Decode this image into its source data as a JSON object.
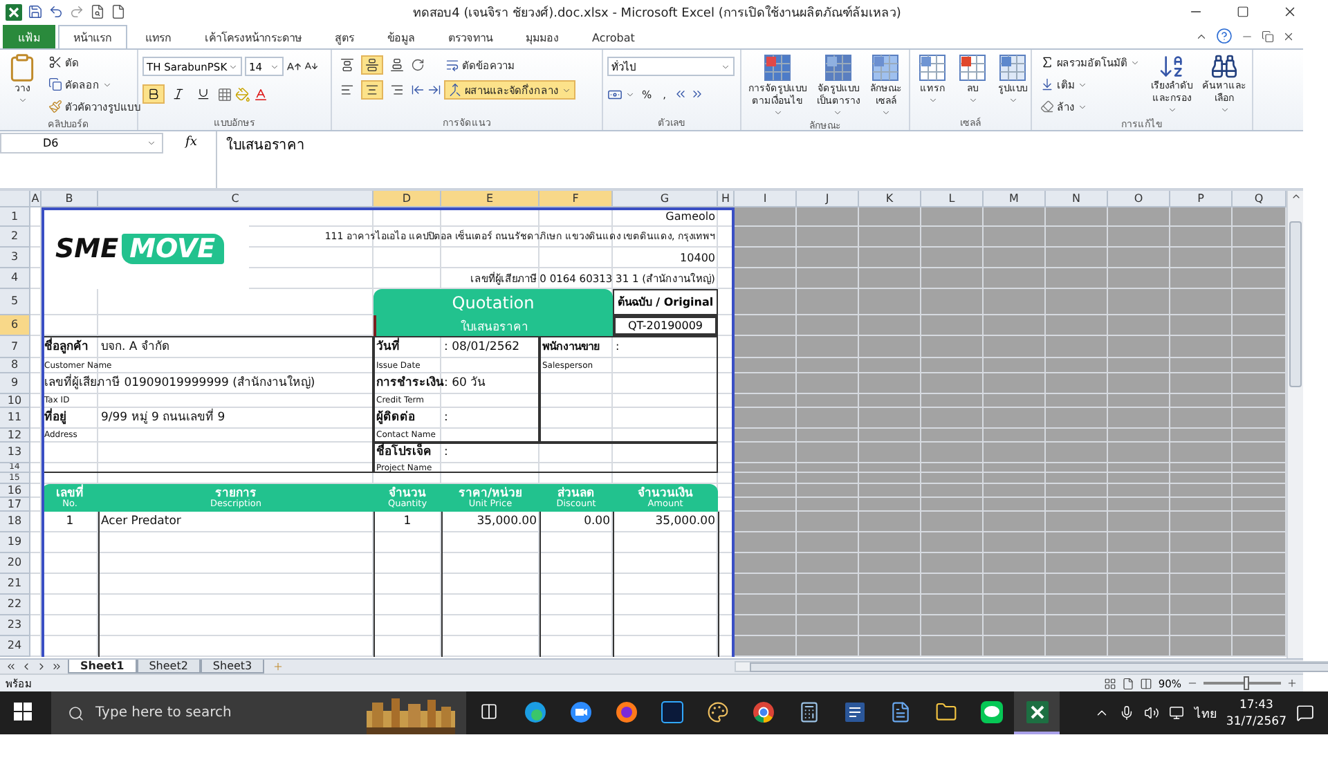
{
  "window": {
    "title": "ทดสอบ4 (เจนจิรา ชัยวงศ์).doc.xlsx - Microsoft Excel (การเปิดใช้งานผลิตภัณฑ์ล้มเหลว)"
  },
  "menu_tabs": [
    {
      "label": "แฟ้ม",
      "kind": "file",
      "selected": false
    },
    {
      "label": "หน้าแรก",
      "kind": "tab",
      "selected": true
    },
    {
      "label": "แทรก",
      "kind": "tab",
      "selected": false
    },
    {
      "label": "เค้าโครงหน้ากระดาษ",
      "kind": "tab",
      "selected": false
    },
    {
      "label": "สูตร",
      "kind": "tab",
      "selected": false
    },
    {
      "label": "ข้อมูล",
      "kind": "tab",
      "selected": false
    },
    {
      "label": "ตรวจทาน",
      "kind": "tab",
      "selected": false
    },
    {
      "label": "มุมมอง",
      "kind": "tab",
      "selected": false
    },
    {
      "label": "Acrobat",
      "kind": "tab",
      "selected": false
    }
  ],
  "clipboard": {
    "label": "คลิปบอร์ด",
    "paste": "วาง",
    "cut": "ตัด",
    "copy": "คัดลอก",
    "format_painter": "ตัวคัดวางรูปแบบ"
  },
  "font": {
    "label": "แบบอักษร",
    "name": "TH SarabunPSK",
    "size": "14",
    "bold": true,
    "italic": false,
    "underline": false
  },
  "alignment": {
    "label": "การจัดแนว",
    "wrap": "ตัดข้อความ",
    "merge": "ผสานและจัดกึ่งกลาง",
    "merge_on": true,
    "vertical": [
      {
        "selected": false
      },
      {
        "selected": true
      },
      {
        "selected": false
      }
    ],
    "horizontal": [
      {
        "selected": false
      },
      {
        "selected": true
      },
      {
        "selected": false
      }
    ]
  },
  "number": {
    "label": "ตัวเลข",
    "format": "ทั่วไป",
    "percent": "%",
    "comma": ","
  },
  "button_groups": [
    {
      "label": "ลักษณะ",
      "buttons": [
        {
          "kind": "conditional",
          "lines": [
            "การจัดรูปแบบ",
            "ตามเงื่อนไข"
          ]
        },
        {
          "kind": "table",
          "lines": [
            "จัดรูปแบบ",
            "เป็นตาราง"
          ]
        },
        {
          "kind": "cellstyle",
          "lines": [
            "ลักษณะ",
            "เซลล์"
          ]
        }
      ]
    },
    {
      "label": "เซลล์",
      "buttons": [
        {
          "kind": "insert",
          "lines": [
            "แทรก"
          ]
        },
        {
          "kind": "delete",
          "lines": [
            "ลบ"
          ]
        },
        {
          "kind": "format",
          "lines": [
            "รูปแบบ"
          ]
        }
      ]
    }
  ],
  "editing": {
    "label": "การแก้ไข",
    "autosum": "ผลรวมอัตโนมัติ",
    "fill": "เติม",
    "clear": "ล้าง",
    "sort": [
      "เรียงลำดับ",
      "และกรอง"
    ],
    "find": [
      "ค้นหาและ",
      "เลือก"
    ]
  },
  "formula_bar": {
    "name_box": "D6",
    "fx": "fx",
    "content": "ใบเสนอราคา"
  },
  "columns": [
    {
      "label": "A",
      "selected": false
    },
    {
      "label": "B",
      "selected": false
    },
    {
      "label": "C",
      "selected": false
    },
    {
      "label": "D",
      "selected": true
    },
    {
      "label": "E",
      "selected": true
    },
    {
      "label": "F",
      "selected": true
    },
    {
      "label": "G",
      "selected": false
    },
    {
      "label": "H",
      "selected": false
    },
    {
      "label": "I",
      "selected": false
    },
    {
      "label": "J",
      "selected": false
    },
    {
      "label": "K",
      "selected": false
    },
    {
      "label": "L",
      "selected": false
    },
    {
      "label": "M",
      "selected": false
    },
    {
      "label": "N",
      "selected": false
    },
    {
      "label": "O",
      "selected": false
    },
    {
      "label": "P",
      "selected": false
    },
    {
      "label": "Q",
      "selected": false
    }
  ],
  "rows": [
    {
      "label": "1",
      "selected": false
    },
    {
      "label": "2",
      "selected": false
    },
    {
      "label": "3",
      "selected": false
    },
    {
      "label": "4",
      "selected": false
    },
    {
      "label": "5",
      "selected": false
    },
    {
      "label": "6",
      "selected": true
    },
    {
      "label": "7",
      "selected": false
    },
    {
      "label": "8",
      "selected": false
    },
    {
      "label": "9",
      "selected": false
    },
    {
      "label": "10",
      "selected": false
    },
    {
      "label": "11",
      "selected": false
    },
    {
      "label": "12",
      "selected": false
    },
    {
      "label": "13",
      "selected": false
    },
    {
      "label": "14",
      "selected": false
    },
    {
      "label": "15",
      "selected": false
    },
    {
      "label": "16",
      "selected": false
    },
    {
      "label": "17",
      "selected": false
    },
    {
      "label": "18",
      "selected": false
    },
    {
      "label": "19",
      "selected": false
    },
    {
      "label": "20",
      "selected": false
    },
    {
      "label": "21",
      "selected": false
    },
    {
      "label": "22",
      "selected": false
    },
    {
      "label": "23",
      "selected": false
    },
    {
      "label": "24",
      "selected": false
    }
  ],
  "logo": {
    "dark": "SME",
    "accent": "MOVE"
  },
  "company": {
    "name": "Gameolo",
    "address": "111  อาคารไอเอไอ แคปปิตอล เซ็นเตอร์ ถนนรัชดาภิเษก แขวงดินแดง เขตดินแดง, กรุงเทพฯ",
    "postcode": "10400",
    "tax_id": "เลขที่ผู้เสียภาษี 0 0164 60313 31 1 (สำนักงานใหญ่)"
  },
  "document": {
    "title": "Quotation",
    "subtitle": "ใบเสนอราคา",
    "copy": "ต้นฉบับ / Original",
    "number": "QT-20190009"
  },
  "customer": [
    {
      "label": "ชื่อลูกค้า",
      "value": "บจก. A จำกัด",
      "sub": "Customer Name"
    },
    {
      "label": "เลขที่ผู้เสียภาษี 01909019999999 (สำนักงานใหญ่)",
      "sub": "Tax ID"
    },
    {
      "label": "ที่อยู่",
      "value": "9/99  หมู่ 9  ถนนเลขที่ 9",
      "sub": "Address"
    }
  ],
  "details": [
    {
      "label": "วันที่",
      "value": ":  08/01/2562",
      "sub": "Issue Date"
    },
    {
      "label": "การชำระเงิน",
      "value": ":  60 วัน",
      "sub": "Credit Term"
    },
    {
      "label": "ผู้ติดต่อ",
      "value": ":",
      "sub": "Contact Name"
    },
    {
      "label": "ชื่อโปรเจ็ค",
      "value": ":",
      "sub": "Project Name"
    }
  ],
  "salesperson": {
    "label": "พนักงานขาย",
    "value": ":",
    "sub": "Salesperson"
  },
  "item_columns": [
    {
      "thai": "เลขที่",
      "english": "No."
    },
    {
      "thai": "รายการ",
      "english": "Description"
    },
    {
      "thai": "จำนวน",
      "english": "Quantity"
    },
    {
      "thai": "ราคา/หน่วย",
      "english": "Unit Price"
    },
    {
      "thai": "ส่วนลด",
      "english": "Discount"
    },
    {
      "thai": "จำนวนเงิน",
      "english": "Amount"
    }
  ],
  "items": [
    {
      "cells": [
        "1",
        "Acer Predator",
        "1",
        "35,000.00",
        "0.00",
        "35,000.00"
      ]
    }
  ],
  "sheet_tabs": [
    {
      "label": "Sheet1",
      "selected": true
    },
    {
      "label": "Sheet2",
      "selected": false
    },
    {
      "label": "Sheet3",
      "selected": false
    }
  ],
  "status_bar": {
    "state": "พร้อม",
    "zoom": "90%",
    "level": 0.55
  },
  "taskbar": {
    "search_placeholder": "Type here to search",
    "language": "ไทย",
    "time": "17:43",
    "date": "31/7/2567"
  }
}
